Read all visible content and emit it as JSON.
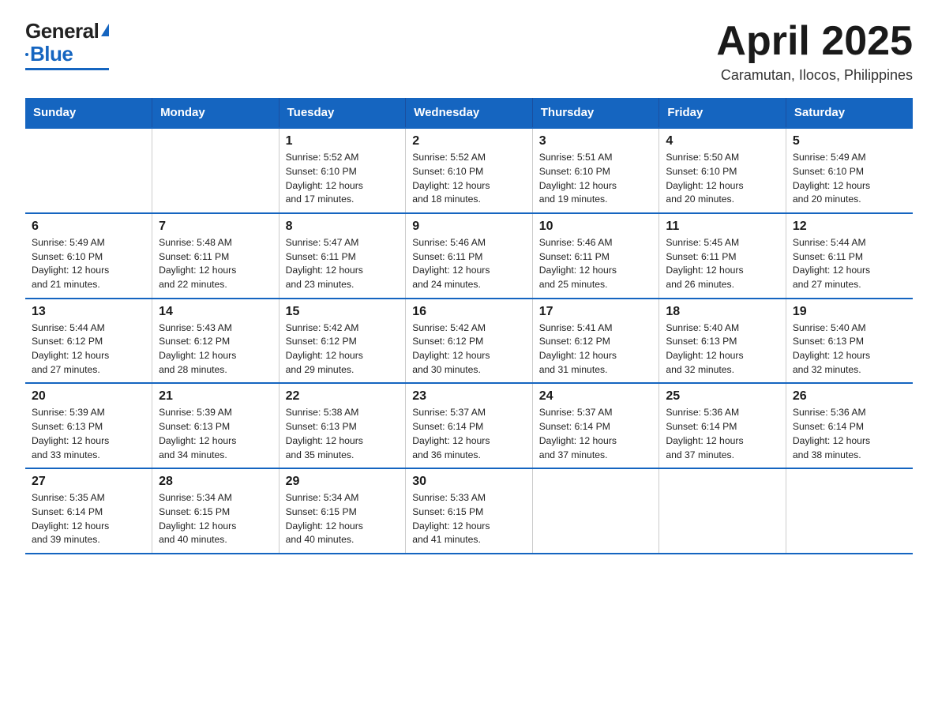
{
  "header": {
    "logo_general": "General",
    "logo_triangle": "▲",
    "logo_blue": "Blue",
    "month_title": "April 2025",
    "location": "Caramutan, Ilocos, Philippines"
  },
  "weekdays": [
    "Sunday",
    "Monday",
    "Tuesday",
    "Wednesday",
    "Thursday",
    "Friday",
    "Saturday"
  ],
  "weeks": [
    [
      {
        "day": "",
        "info": ""
      },
      {
        "day": "",
        "info": ""
      },
      {
        "day": "1",
        "info": "Sunrise: 5:52 AM\nSunset: 6:10 PM\nDaylight: 12 hours\nand 17 minutes."
      },
      {
        "day": "2",
        "info": "Sunrise: 5:52 AM\nSunset: 6:10 PM\nDaylight: 12 hours\nand 18 minutes."
      },
      {
        "day": "3",
        "info": "Sunrise: 5:51 AM\nSunset: 6:10 PM\nDaylight: 12 hours\nand 19 minutes."
      },
      {
        "day": "4",
        "info": "Sunrise: 5:50 AM\nSunset: 6:10 PM\nDaylight: 12 hours\nand 20 minutes."
      },
      {
        "day": "5",
        "info": "Sunrise: 5:49 AM\nSunset: 6:10 PM\nDaylight: 12 hours\nand 20 minutes."
      }
    ],
    [
      {
        "day": "6",
        "info": "Sunrise: 5:49 AM\nSunset: 6:10 PM\nDaylight: 12 hours\nand 21 minutes."
      },
      {
        "day": "7",
        "info": "Sunrise: 5:48 AM\nSunset: 6:11 PM\nDaylight: 12 hours\nand 22 minutes."
      },
      {
        "day": "8",
        "info": "Sunrise: 5:47 AM\nSunset: 6:11 PM\nDaylight: 12 hours\nand 23 minutes."
      },
      {
        "day": "9",
        "info": "Sunrise: 5:46 AM\nSunset: 6:11 PM\nDaylight: 12 hours\nand 24 minutes."
      },
      {
        "day": "10",
        "info": "Sunrise: 5:46 AM\nSunset: 6:11 PM\nDaylight: 12 hours\nand 25 minutes."
      },
      {
        "day": "11",
        "info": "Sunrise: 5:45 AM\nSunset: 6:11 PM\nDaylight: 12 hours\nand 26 minutes."
      },
      {
        "day": "12",
        "info": "Sunrise: 5:44 AM\nSunset: 6:11 PM\nDaylight: 12 hours\nand 27 minutes."
      }
    ],
    [
      {
        "day": "13",
        "info": "Sunrise: 5:44 AM\nSunset: 6:12 PM\nDaylight: 12 hours\nand 27 minutes."
      },
      {
        "day": "14",
        "info": "Sunrise: 5:43 AM\nSunset: 6:12 PM\nDaylight: 12 hours\nand 28 minutes."
      },
      {
        "day": "15",
        "info": "Sunrise: 5:42 AM\nSunset: 6:12 PM\nDaylight: 12 hours\nand 29 minutes."
      },
      {
        "day": "16",
        "info": "Sunrise: 5:42 AM\nSunset: 6:12 PM\nDaylight: 12 hours\nand 30 minutes."
      },
      {
        "day": "17",
        "info": "Sunrise: 5:41 AM\nSunset: 6:12 PM\nDaylight: 12 hours\nand 31 minutes."
      },
      {
        "day": "18",
        "info": "Sunrise: 5:40 AM\nSunset: 6:13 PM\nDaylight: 12 hours\nand 32 minutes."
      },
      {
        "day": "19",
        "info": "Sunrise: 5:40 AM\nSunset: 6:13 PM\nDaylight: 12 hours\nand 32 minutes."
      }
    ],
    [
      {
        "day": "20",
        "info": "Sunrise: 5:39 AM\nSunset: 6:13 PM\nDaylight: 12 hours\nand 33 minutes."
      },
      {
        "day": "21",
        "info": "Sunrise: 5:39 AM\nSunset: 6:13 PM\nDaylight: 12 hours\nand 34 minutes."
      },
      {
        "day": "22",
        "info": "Sunrise: 5:38 AM\nSunset: 6:13 PM\nDaylight: 12 hours\nand 35 minutes."
      },
      {
        "day": "23",
        "info": "Sunrise: 5:37 AM\nSunset: 6:14 PM\nDaylight: 12 hours\nand 36 minutes."
      },
      {
        "day": "24",
        "info": "Sunrise: 5:37 AM\nSunset: 6:14 PM\nDaylight: 12 hours\nand 37 minutes."
      },
      {
        "day": "25",
        "info": "Sunrise: 5:36 AM\nSunset: 6:14 PM\nDaylight: 12 hours\nand 37 minutes."
      },
      {
        "day": "26",
        "info": "Sunrise: 5:36 AM\nSunset: 6:14 PM\nDaylight: 12 hours\nand 38 minutes."
      }
    ],
    [
      {
        "day": "27",
        "info": "Sunrise: 5:35 AM\nSunset: 6:14 PM\nDaylight: 12 hours\nand 39 minutes."
      },
      {
        "day": "28",
        "info": "Sunrise: 5:34 AM\nSunset: 6:15 PM\nDaylight: 12 hours\nand 40 minutes."
      },
      {
        "day": "29",
        "info": "Sunrise: 5:34 AM\nSunset: 6:15 PM\nDaylight: 12 hours\nand 40 minutes."
      },
      {
        "day": "30",
        "info": "Sunrise: 5:33 AM\nSunset: 6:15 PM\nDaylight: 12 hours\nand 41 minutes."
      },
      {
        "day": "",
        "info": ""
      },
      {
        "day": "",
        "info": ""
      },
      {
        "day": "",
        "info": ""
      }
    ]
  ]
}
